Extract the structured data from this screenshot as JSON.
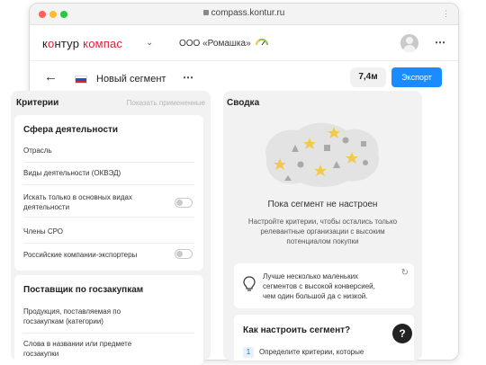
{
  "browser": {
    "url": "compass.kontur.ru"
  },
  "app": {
    "logo_prefix_1": "к",
    "logo_o": "о",
    "logo_prefix_2": "нтур",
    "logo_product": "компас",
    "org_name": "ООО «Ромашка»"
  },
  "segment": {
    "title": "Новый сегмент",
    "count": "7,4м",
    "export_label": "Экспорт"
  },
  "criteria": {
    "heading": "Критерии",
    "show_applied": "Показать примененные",
    "sections": [
      {
        "title": "Сфера деятельности",
        "items": [
          "Отрасль",
          "Виды деятельности (ОКВЭД)",
          "Искать только в основных видах деятельности",
          "Члены СРО",
          "Российские компании-экспортеры"
        ]
      },
      {
        "title": "Поставщик по госзакупкам",
        "items": [
          "Продукция, поставляемая по госзакупкам (категории)",
          "Слова в названии или предмете госзакупки"
        ]
      }
    ]
  },
  "summary": {
    "heading": "Сводка",
    "empty_title": "Пока сегмент не настроен",
    "empty_desc": "Настройте критерии, чтобы остались только релевантные организации с высоким потенциалом покупки",
    "tip": "Лучше несколько маленьких сегментов с высокой конверсией, чем один большой да с низкой.",
    "how_title": "Как настроить сегмент?",
    "step_num": "1",
    "step_text": "Определите критерии, которые"
  },
  "help_label": "?",
  "colors": {
    "accent": "#1a8cff",
    "brand_red": "#e31d2e",
    "star": "#f2c94c"
  }
}
